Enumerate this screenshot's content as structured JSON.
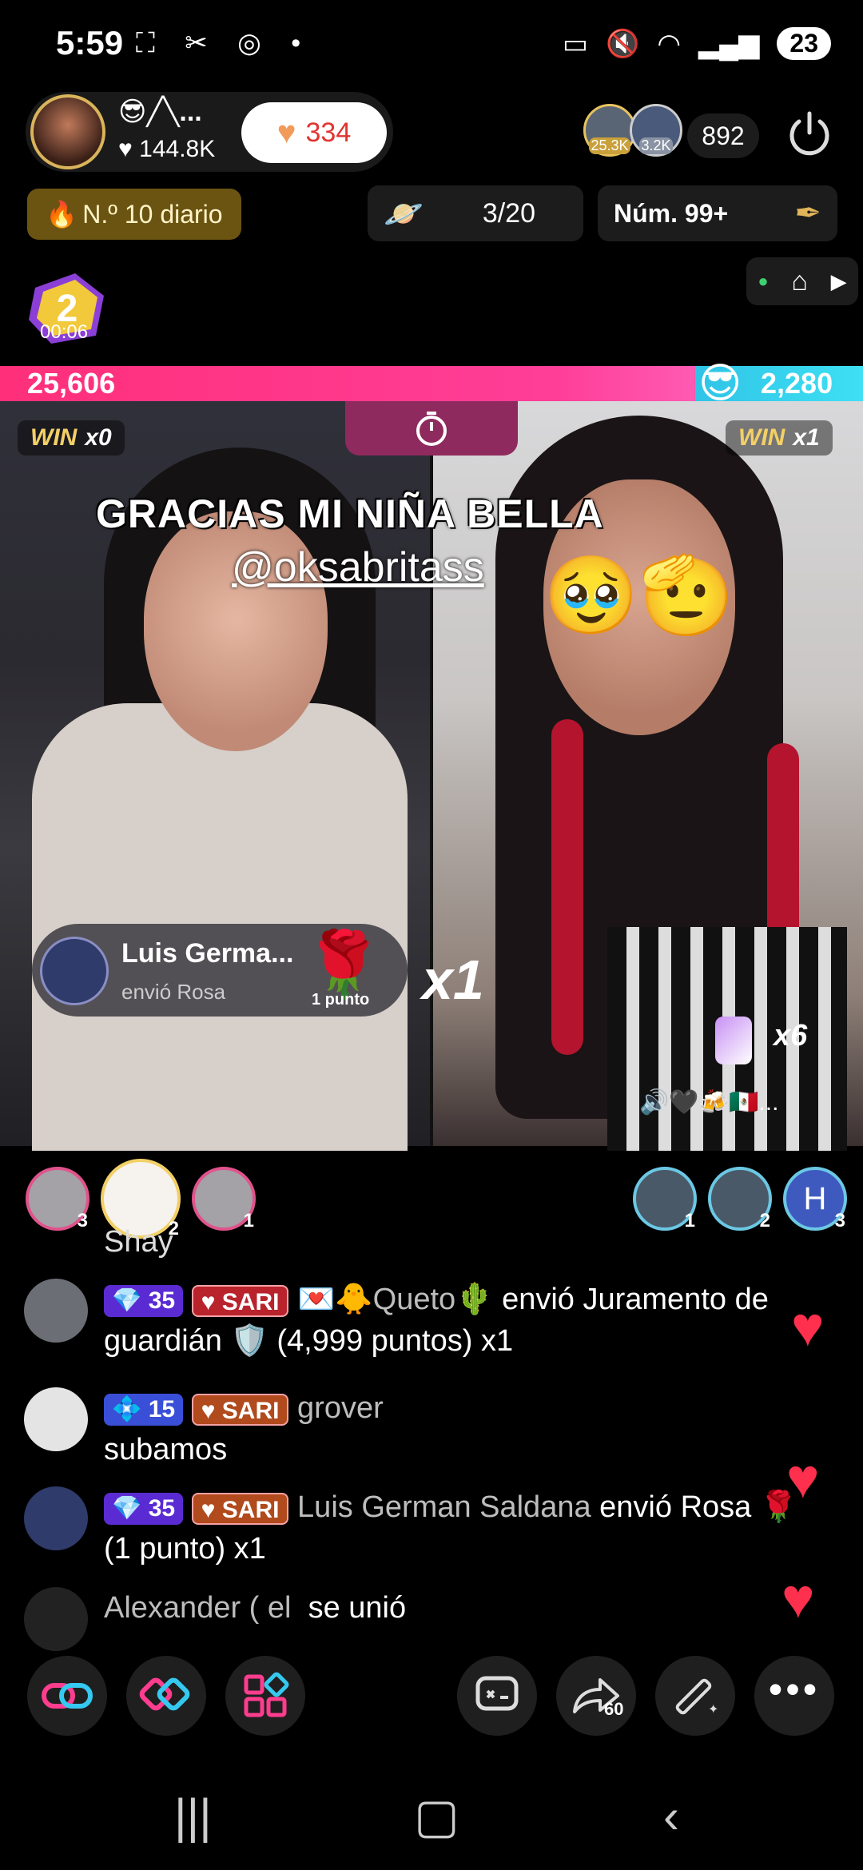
{
  "status": {
    "time": "5:59",
    "battery": "23"
  },
  "host": {
    "name": "😎╱╲...",
    "likes": "♥ 144.8K",
    "heart_count": "334"
  },
  "viewers": {
    "v1_count": "25.3K",
    "v2_count": "3.2K",
    "total": "892"
  },
  "ranking": {
    "daily": "N.º 10 diario",
    "tasks": "3/20",
    "num": "Núm. 99+"
  },
  "timer_badge": "00:06",
  "battle": {
    "score_left": "25,606",
    "score_right": "2,280",
    "win_left_label": "WIN",
    "win_left_count": "x0",
    "win_right_label": "WIN",
    "win_right_count": "x1"
  },
  "overlay": {
    "text": "GRACIAS MI NIÑA BELLA",
    "mention": "@oksabritass",
    "emojis": "🥹🫡"
  },
  "gift_popup": {
    "name": "Luis Germa...",
    "action": "envió Rosa",
    "points": "1 punto",
    "multiplier": "x1"
  },
  "right_gift": {
    "multiplier": "x6",
    "audio": "🔊🖤🍻🇲🇽..."
  },
  "ranked_avatars": {
    "left": [
      {
        "n": "3"
      },
      {
        "n": "2"
      },
      {
        "n": "1"
      }
    ],
    "right": [
      {
        "n": "1"
      },
      {
        "n": "2"
      },
      {
        "n": "3",
        "letter": "H"
      }
    ]
  },
  "chat": [
    {
      "partial": "Shay"
    },
    {
      "level": "35",
      "tag": "SARI",
      "user": "💌🐥Queto🌵",
      "text": " envió Juramento de guardián 🛡️ (4,999 puntos) x1"
    },
    {
      "level": "15",
      "tag": "SARI",
      "user": "grover",
      "text": "subamos"
    },
    {
      "level": "35",
      "tag": "SARI",
      "user": "Luis German Saldana",
      "text": " envió Rosa 🌹 (1 punto) x1"
    },
    {
      "user": "Alexander ( el",
      "text": "se unió"
    }
  ],
  "colors": {
    "score_pink": "#ff2f7a",
    "score_blue": "#30c4e6",
    "rank_gold": "#6b5412",
    "heart_red": "#ff2f4e"
  },
  "toolbar_icons": [
    "link-icon",
    "battle-icon",
    "apps-icon",
    "comment-icon",
    "share-icon",
    "magic-wand-icon",
    "more-icon"
  ],
  "share_count": "60"
}
